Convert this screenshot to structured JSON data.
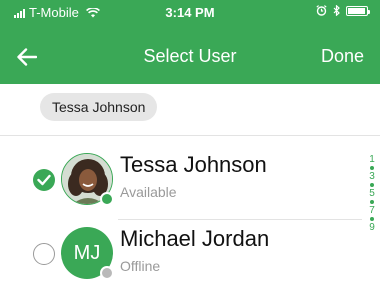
{
  "status_bar": {
    "carrier": "T-Mobile",
    "time": "3:14 PM"
  },
  "nav": {
    "title": "Select User",
    "done_label": "Done"
  },
  "selected_chips": [
    "Tessa Johnson"
  ],
  "users": [
    {
      "name": "Tessa Johnson",
      "status": "Available",
      "selected": true,
      "presence": "online"
    },
    {
      "name": "Michael Jordan",
      "initials": "MJ",
      "status": "Offline",
      "selected": false,
      "presence": "offline"
    }
  ],
  "index": [
    "1",
    "3",
    "5",
    "7",
    "9"
  ],
  "colors": {
    "brand_green": "#3aa856",
    "chip_bg": "#e6e6e6",
    "muted_text": "#9a9a9a"
  }
}
